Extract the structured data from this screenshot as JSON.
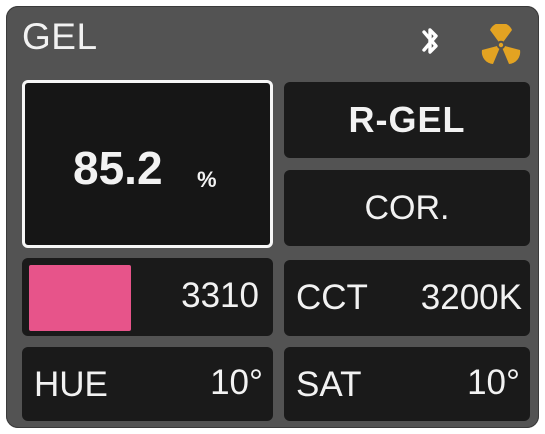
{
  "header": {
    "title": "GEL",
    "icons": {
      "bluetooth": "bluetooth-icon",
      "fan": "fan-icon"
    },
    "colors": {
      "fan_icon": "#e3a322",
      "bluetooth_icon": "#ffffff"
    }
  },
  "intensity": {
    "value": "85.2",
    "unit": "%"
  },
  "gel_type": {
    "label": "R-GEL"
  },
  "correction": {
    "label": "COR."
  },
  "gel": {
    "number": "3310",
    "swatch_color": "#e7548a"
  },
  "cct": {
    "label": "CCT",
    "value": "3200K"
  },
  "hue": {
    "label": "HUE",
    "value": "10°"
  },
  "saturation": {
    "label": "SAT",
    "value": "10°"
  },
  "colors": {
    "screen_background": "#535353",
    "tile_background": "#1a1a1a",
    "text": "#f2f2f2",
    "selected_border": "#f7f7f7"
  }
}
